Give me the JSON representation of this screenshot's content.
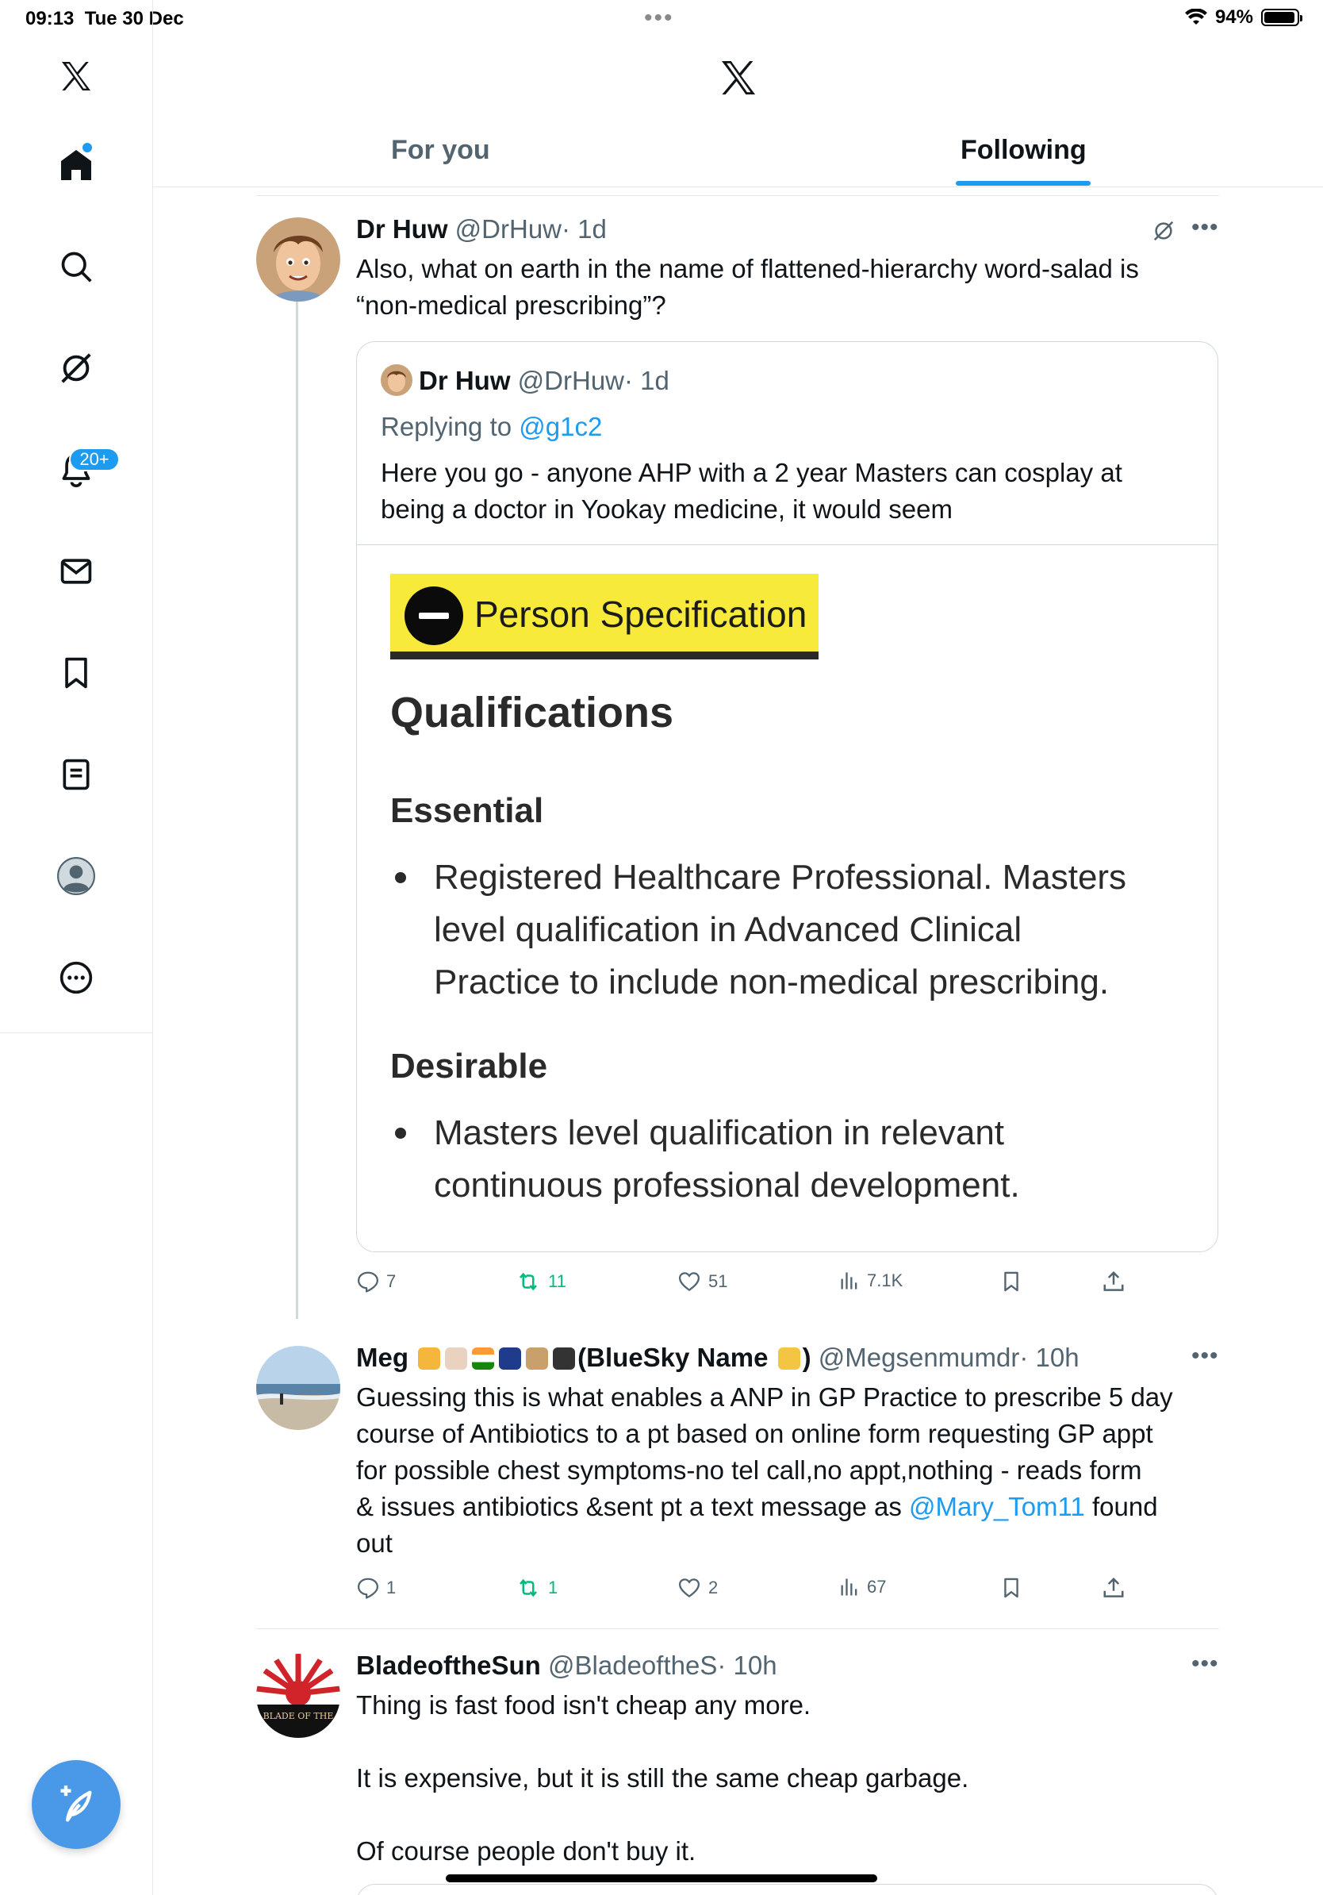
{
  "status_bar": {
    "time": "09:13",
    "date": "Tue 30 Dec",
    "battery": "94%"
  },
  "sidebar": {
    "items": [
      {
        "name": "x-logo"
      },
      {
        "name": "home"
      },
      {
        "name": "search"
      },
      {
        "name": "grok"
      },
      {
        "name": "notifications",
        "badge": "20+"
      },
      {
        "name": "messages"
      },
      {
        "name": "bookmarks"
      },
      {
        "name": "lists"
      },
      {
        "name": "profile"
      },
      {
        "name": "more"
      }
    ]
  },
  "header": {
    "tabs": [
      {
        "label": "For you",
        "active": false
      },
      {
        "label": "Following",
        "active": true
      }
    ]
  },
  "tweets": [
    {
      "name": "Dr Huw",
      "handle": "@DrHuw",
      "time": "· 1d",
      "text_1": "Also, what on earth in the name of flattened-hierarchy word-salad is",
      "text_2": "“non-medical prescribing”?",
      "quote": {
        "name": "Dr Huw",
        "handle": "@DrHuw",
        "time": "· 1d",
        "replying_prefix": "Replying to ",
        "replying_handle": "@g1c2",
        "text_1": "Here you go - anyone AHP with a 2 year Masters can cosplay at",
        "text_2": "being a doctor in Yookay medicine, it would seem",
        "image": {
          "banner": "Person Specification",
          "heading": "Qualifications",
          "essential_label": "Essential",
          "essential_1": "Registered Healthcare Professional. Masters",
          "essential_2": "level qualification in Advanced Clinical",
          "essential_3": "Practice to include non-medical prescribing.",
          "desirable_label": "Desirable",
          "desirable_1": "Masters level qualification in relevant",
          "desirable_2": "continuous professional development."
        }
      },
      "replies": "7",
      "reposts": "11",
      "likes": "51",
      "views": "7.1K"
    },
    {
      "name_prefix": "Meg",
      "name_suffix": "(BlueSky Name",
      "name_close": ")",
      "handle": "@Megsenmumdr",
      "time": "· 10h",
      "text_1": "Guessing this is what enables a ANP in GP Practice to prescribe 5 day",
      "text_2": "course of Antibiotics to a pt based on online form requesting GP appt",
      "text_3": "for possible chest symptoms-no tel call,no appt,nothing - reads form",
      "text_4_a": "& issues antibiotics &sent pt a text message as ",
      "text_4_link": "@Mary_Tom11",
      "text_4_b": " found",
      "text_5": "out",
      "replies": "1",
      "reposts": "1",
      "likes": "2",
      "views": "67"
    },
    {
      "name": "BladeoftheSun",
      "handle": "@BladeoftheS",
      "time": "· 10h",
      "avatar_text": "BLADE OF THE",
      "text_1": "Thing is fast food isn't cheap any more.",
      "text_2": "It is expensive, but it is still the same cheap garbage.",
      "text_3": "Of course people don't buy it."
    }
  ],
  "colors": {
    "accent": "#1d9bf0",
    "repost": "#00ba7c",
    "muted": "#536471"
  }
}
